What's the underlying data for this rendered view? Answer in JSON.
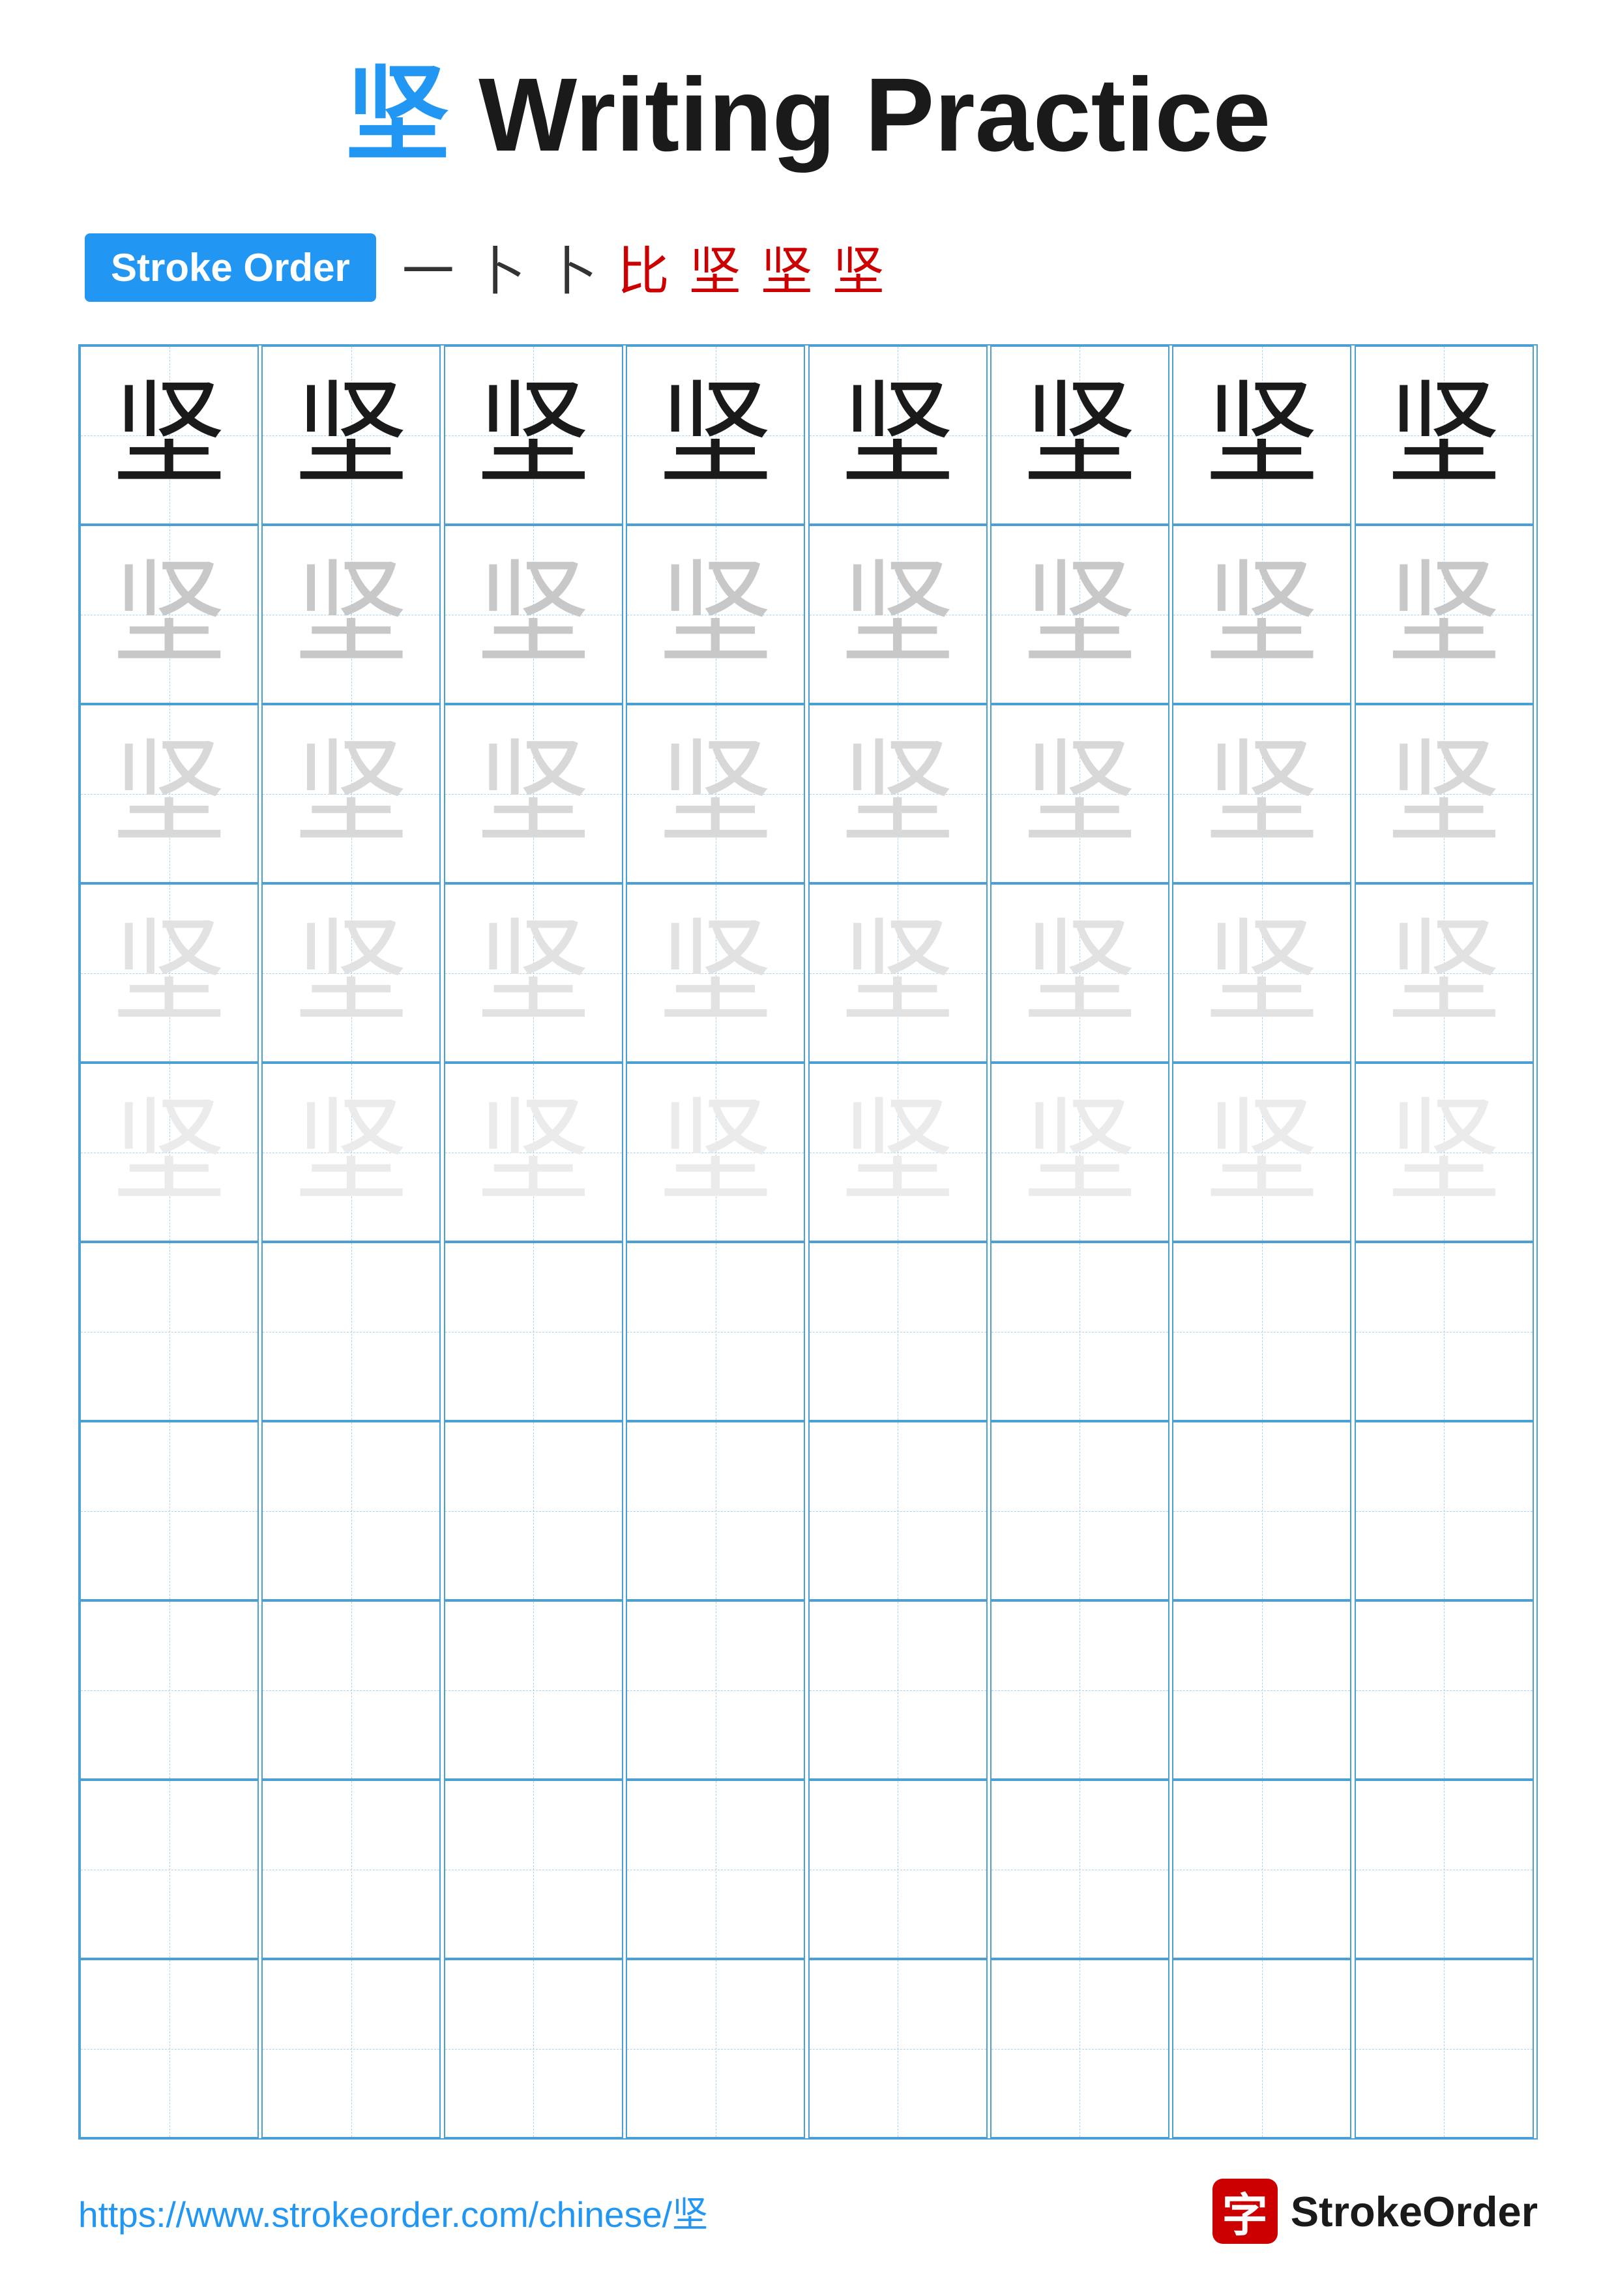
{
  "title": {
    "char": "坚",
    "suffix": " Writing Practice",
    "full": "坚 Writing Practice"
  },
  "stroke_order": {
    "badge_label": "Stroke Order",
    "steps": [
      "一",
      "卜",
      "卜",
      "比",
      "坚",
      "坚",
      "坚"
    ]
  },
  "grid": {
    "rows": 10,
    "cols": 8,
    "char": "坚",
    "row_styles": [
      "dark",
      "medium-gray",
      "light-gray",
      "very-light",
      "ultra-light",
      "empty",
      "empty",
      "empty",
      "empty",
      "empty"
    ]
  },
  "footer": {
    "url": "https://www.strokeorder.com/chinese/坚",
    "logo_char": "字",
    "logo_text": "StrokeOrder"
  }
}
